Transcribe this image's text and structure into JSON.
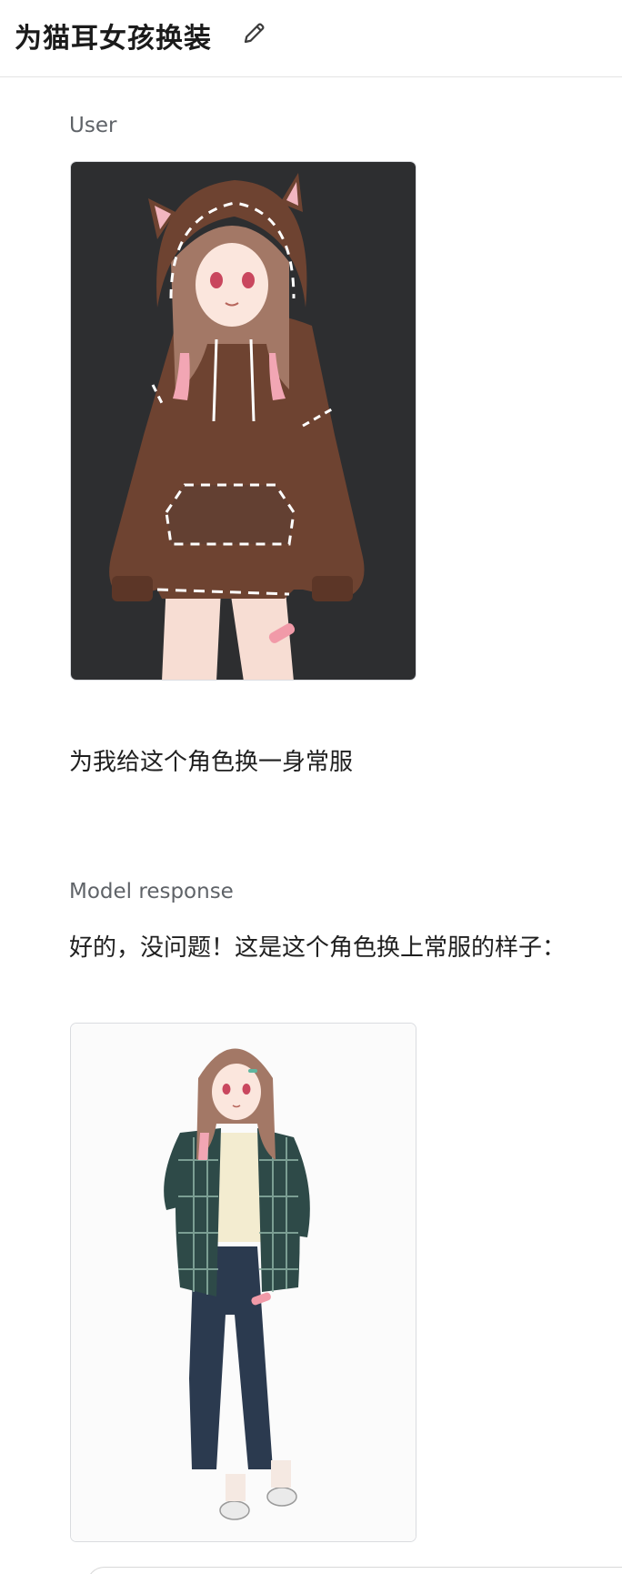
{
  "header": {
    "title": "为猫耳女孩换装",
    "edit_icon": "pencil-icon"
  },
  "conversation": {
    "user_label": "User",
    "user_message": "为我给这个角色换一身常服",
    "model_label": "Model response",
    "model_message": "好的，没问题！这是这个角色换上常服的样子："
  },
  "colors": {
    "user_image_bg": "#2d2e30",
    "model_image_bg": "#fbfbfb",
    "hoodie": "#6e4331",
    "shirt_plaid": "#2e4a48",
    "jeans": "#2b3a4f"
  }
}
